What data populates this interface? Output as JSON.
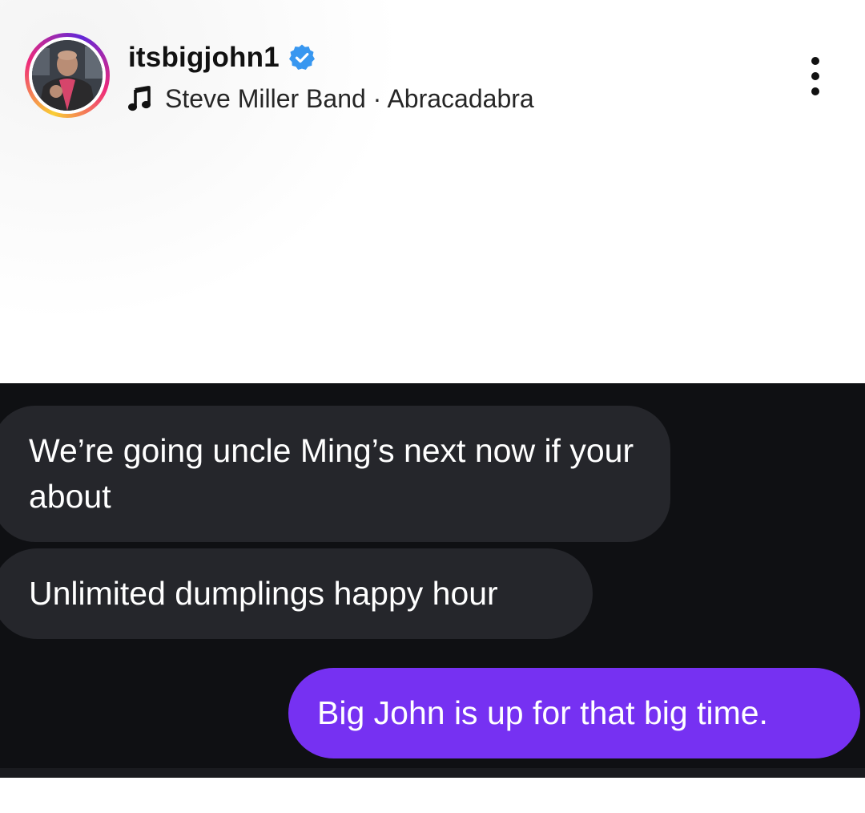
{
  "post_header": {
    "username": "itsbigjohn1",
    "verified": true,
    "verified_icon": "verified-badge-icon",
    "music_icon": "music-note-icon",
    "music_text": "Steve Miller Band · Abracadabra",
    "more_icon": "more-vertical-icon",
    "avatar_ring_colors": [
      "#f9ce34",
      "#ee2a7b",
      "#6228d7"
    ]
  },
  "chat": {
    "background": "#0f1013",
    "messages": [
      {
        "side": "received",
        "text": "We’re going uncle Ming’s next now if your about",
        "color": "#25262b"
      },
      {
        "side": "received",
        "text": "Unlimited dumplings happy hour",
        "color": "#25262b"
      },
      {
        "side": "sent",
        "text": "Big John is up for that big time.",
        "color": "#7631f2"
      }
    ]
  }
}
